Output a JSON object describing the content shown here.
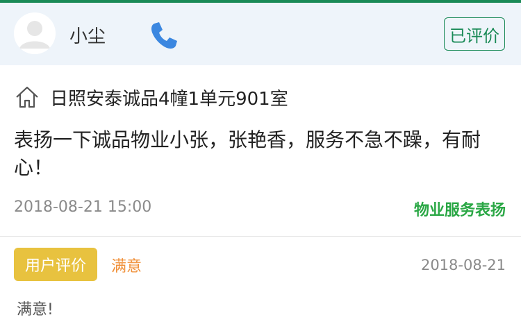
{
  "header": {
    "user_name": "小尘",
    "rated_label": "已评价",
    "icons": {
      "avatar": "default-avatar",
      "phone": "phone-icon"
    },
    "colors": {
      "accent": "#1a8a57",
      "phone": "#3b87e0"
    }
  },
  "record": {
    "address": "日照安泰诚品4幢1单元901室",
    "comment": "表扬一下诚品物业小张，张艳香，服务不急不躁，有耐心！",
    "timestamp": "2018-08-21 15:00",
    "category": "物业服务表扬",
    "category_color": "#2aa745",
    "icon": "home-icon"
  },
  "evaluation": {
    "badge": "用户评价",
    "badge_color": "#e8c23f",
    "satisfaction": "满意",
    "date": "2018-08-21",
    "text": "满意!"
  }
}
